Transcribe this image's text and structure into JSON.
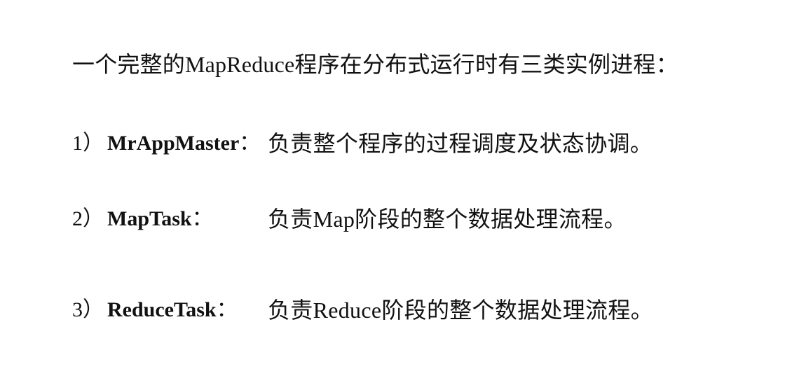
{
  "document": {
    "heading": "一个完整的MapReduce程序在分布式运行时有三类实例进程：",
    "items": [
      {
        "number": "1）",
        "role": "MrAppMaster",
        "colon": "：",
        "description": "负责整个程序的过程调度及状态协调。"
      },
      {
        "number": "2）",
        "role": "MapTask",
        "colon": "：",
        "description": "负责Map阶段的整个数据处理流程。"
      },
      {
        "number": "3）",
        "role": "ReduceTask",
        "colon": "：",
        "description": "负责Reduce阶段的整个数据处理流程。"
      }
    ]
  }
}
